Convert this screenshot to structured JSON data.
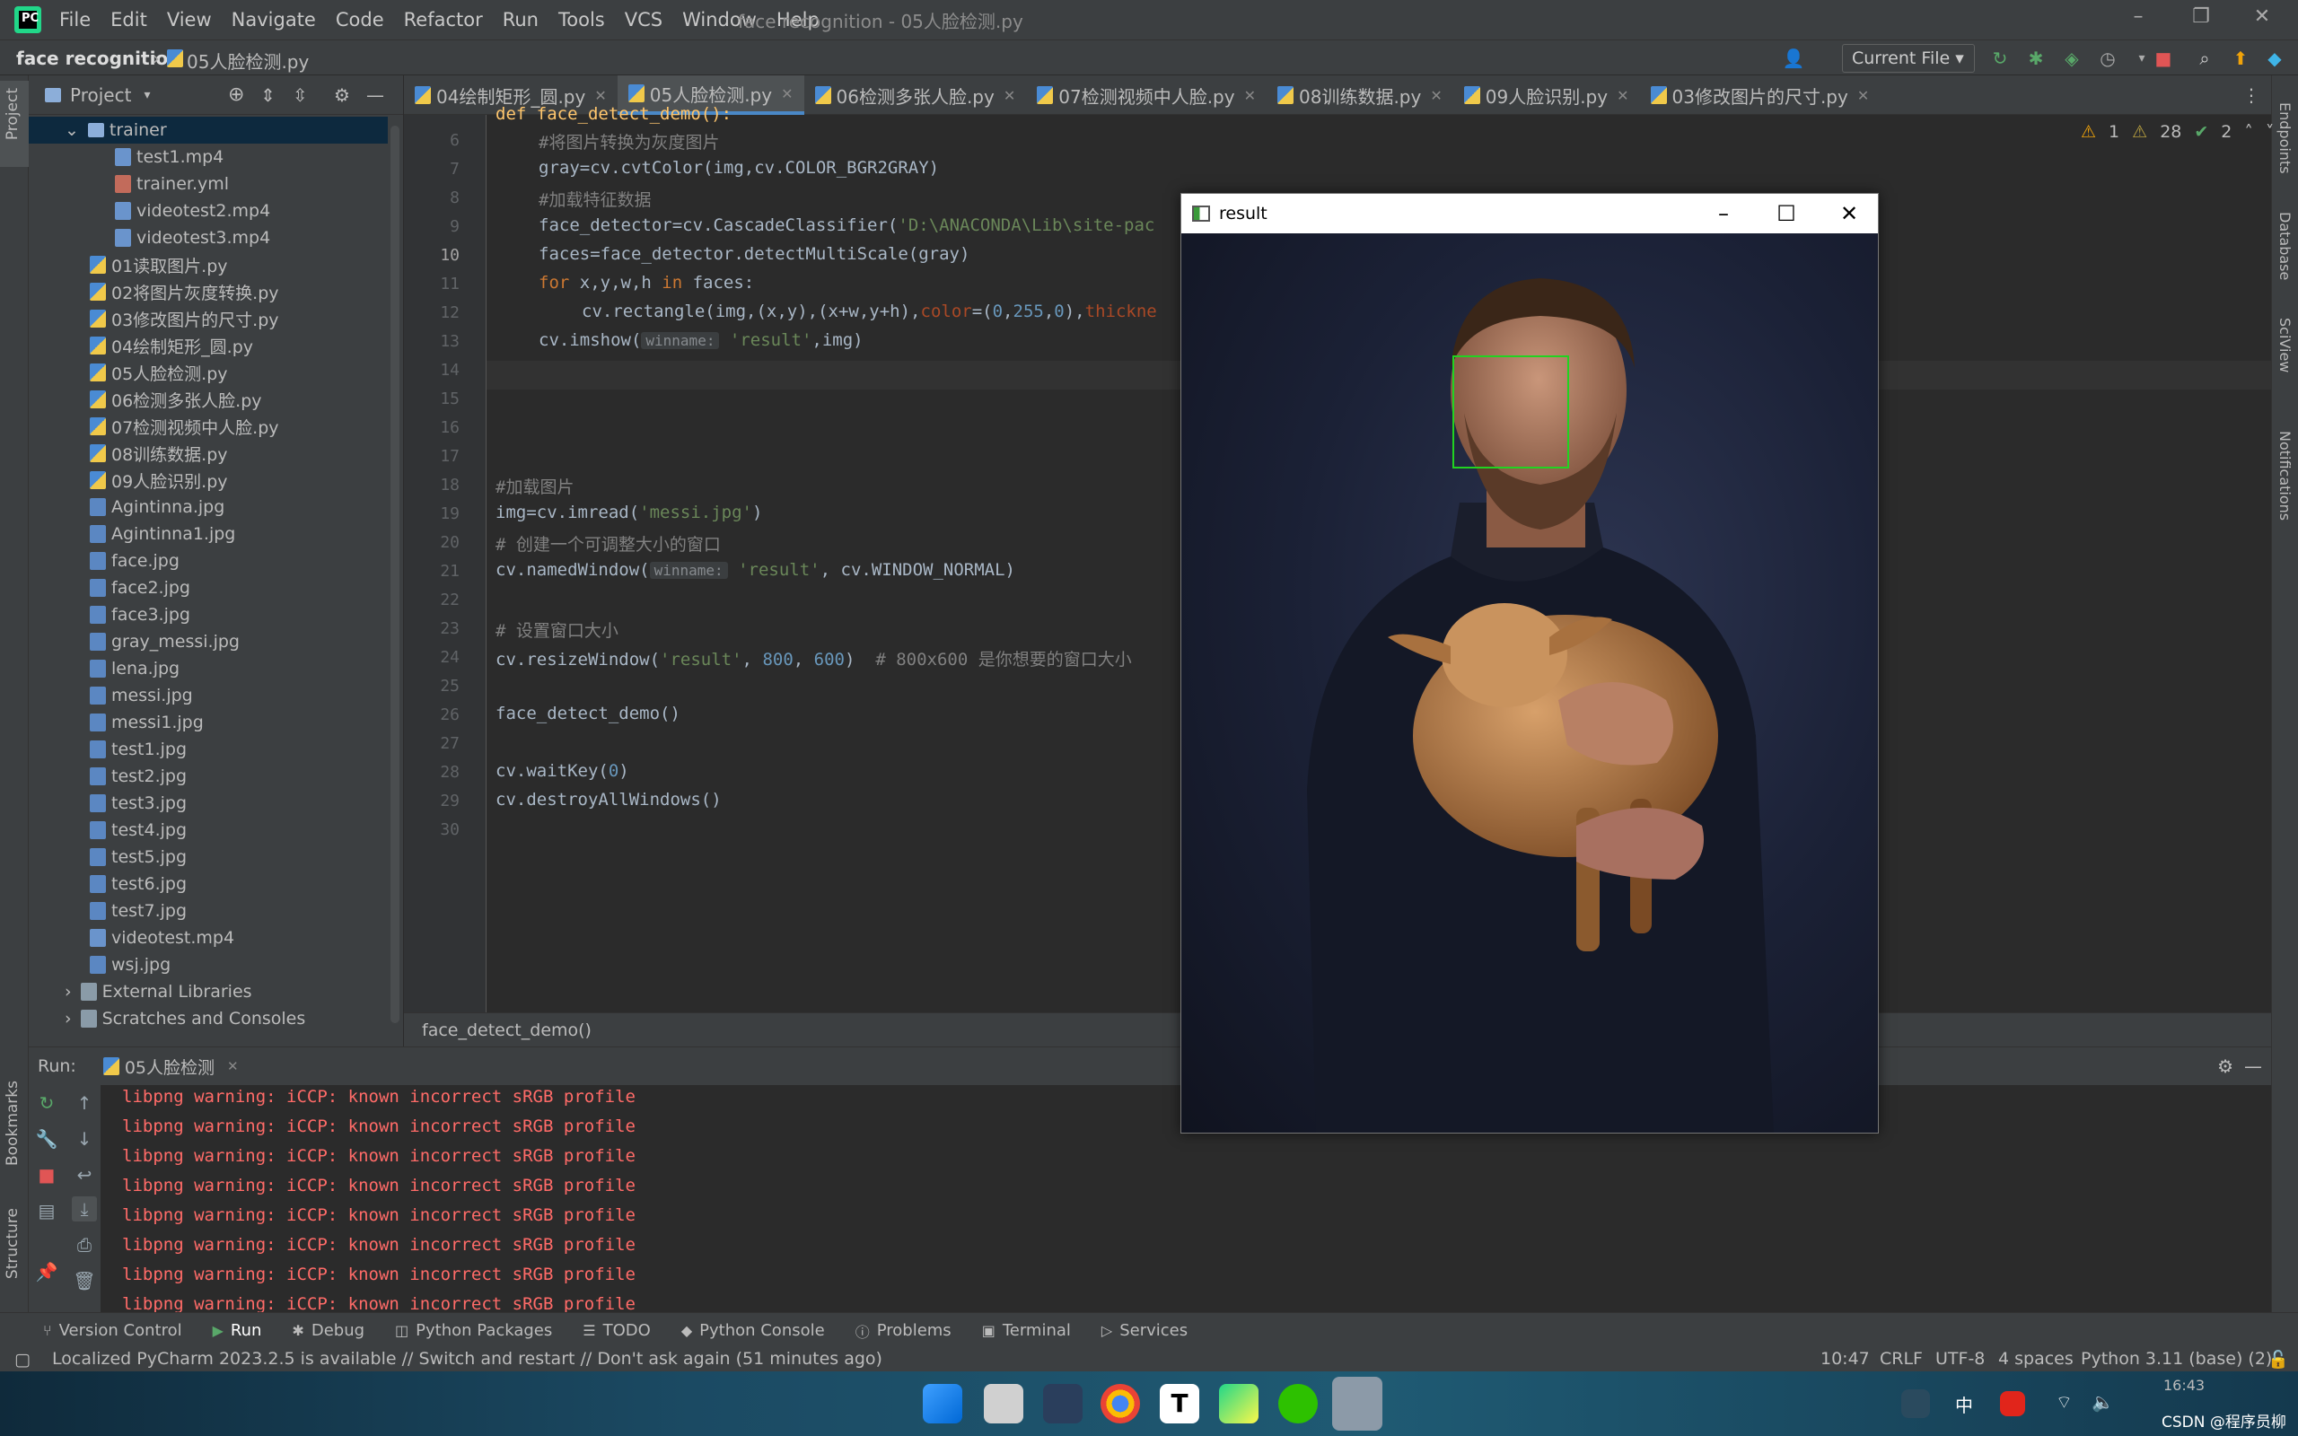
{
  "app": {
    "logo_text": "PC",
    "menu": [
      "File",
      "Edit",
      "View",
      "Navigate",
      "Code",
      "Refactor",
      "Run",
      "Tools",
      "VCS",
      "Window",
      "Help"
    ],
    "window_title": "face recognition - 05人脸检测.py"
  },
  "navbar": {
    "project": "face recognition",
    "file": "05人脸检测.py",
    "run_config": "Current File"
  },
  "left_tool_tabs": [
    "Project",
    "Bookmarks",
    "Structure"
  ],
  "right_tool_tabs": [
    "Endpoints",
    "Database",
    "SciView",
    "Notifications"
  ],
  "project_panel": {
    "title": "Project",
    "tree": [
      {
        "label": "trainer",
        "type": "folder",
        "indent": 1,
        "expanded": true
      },
      {
        "label": "test1.mp4",
        "type": "mp4",
        "indent": 2
      },
      {
        "label": "trainer.yml",
        "type": "yml",
        "indent": 2
      },
      {
        "label": "videotest2.mp4",
        "type": "mp4",
        "indent": 2
      },
      {
        "label": "videotest3.mp4",
        "type": "mp4",
        "indent": 2
      },
      {
        "label": "01读取图片.py",
        "type": "py",
        "indent": 1
      },
      {
        "label": "02将图片灰度转换.py",
        "type": "py",
        "indent": 1
      },
      {
        "label": "03修改图片的尺寸.py",
        "type": "py",
        "indent": 1
      },
      {
        "label": "04绘制矩形_圆.py",
        "type": "py",
        "indent": 1
      },
      {
        "label": "05人脸检测.py",
        "type": "py",
        "indent": 1
      },
      {
        "label": "06检测多张人脸.py",
        "type": "py",
        "indent": 1
      },
      {
        "label": "07检测视频中人脸.py",
        "type": "py",
        "indent": 1
      },
      {
        "label": "08训练数据.py",
        "type": "py",
        "indent": 1
      },
      {
        "label": "09人脸识别.py",
        "type": "py",
        "indent": 1
      },
      {
        "label": "Agintinna.jpg",
        "type": "img",
        "indent": 1
      },
      {
        "label": "Agintinna1.jpg",
        "type": "img",
        "indent": 1
      },
      {
        "label": "face.jpg",
        "type": "img",
        "indent": 1
      },
      {
        "label": "face2.jpg",
        "type": "img",
        "indent": 1
      },
      {
        "label": "face3.jpg",
        "type": "img",
        "indent": 1
      },
      {
        "label": "gray_messi.jpg",
        "type": "img",
        "indent": 1
      },
      {
        "label": "lena.jpg",
        "type": "img",
        "indent": 1
      },
      {
        "label": "messi.jpg",
        "type": "img",
        "indent": 1
      },
      {
        "label": "messi1.jpg",
        "type": "img",
        "indent": 1
      },
      {
        "label": "test1.jpg",
        "type": "img",
        "indent": 1
      },
      {
        "label": "test2.jpg",
        "type": "img",
        "indent": 1
      },
      {
        "label": "test3.jpg",
        "type": "img",
        "indent": 1
      },
      {
        "label": "test4.jpg",
        "type": "img",
        "indent": 1
      },
      {
        "label": "test5.jpg",
        "type": "img",
        "indent": 1
      },
      {
        "label": "test6.jpg",
        "type": "img",
        "indent": 1
      },
      {
        "label": "test7.jpg",
        "type": "img",
        "indent": 1
      },
      {
        "label": "videotest.mp4",
        "type": "mp4",
        "indent": 1
      },
      {
        "label": "wsj.jpg",
        "type": "img",
        "indent": 1
      },
      {
        "label": "External Libraries",
        "type": "lib",
        "indent": 0
      },
      {
        "label": "Scratches and Consoles",
        "type": "lib",
        "indent": 0
      }
    ]
  },
  "tabs": [
    {
      "label": "04绘制矩形_圆.py",
      "active": false
    },
    {
      "label": "05人脸检测.py",
      "active": true
    },
    {
      "label": "06检测多张人脸.py",
      "active": false
    },
    {
      "label": "07检测视频中人脸.py",
      "active": false
    },
    {
      "label": "08训练数据.py",
      "active": false
    },
    {
      "label": "09人脸识别.py",
      "active": false
    },
    {
      "label": "03修改图片的尺寸.py",
      "active": false
    }
  ],
  "inspections": {
    "warnings": "1",
    "weak": "28",
    "ok": "2"
  },
  "editor": {
    "line_numbers": [
      "6",
      "7",
      "8",
      "9",
      "10",
      "11",
      "12",
      "13",
      "14",
      "15",
      "16",
      "17",
      "18",
      "19",
      "20",
      "21",
      "22",
      "23",
      "24",
      "25",
      "26",
      "27",
      "28",
      "29",
      "30"
    ],
    "top_partial": "def face_detect_demo():",
    "lines": {
      "l6": "#将图片转换为灰度图片",
      "l7a": "gray=cv.cvtColor(img",
      "l7b": ",cv.COLOR_BGR2GRAY)",
      "l8": "#加载特征数据",
      "l9a": "face_detector=cv.CascadeClassifier(",
      "l9b": "'D:\\ANACONDA\\Lib\\site-pac",
      "l10": "faces=face_detector.detectMultiScale(gray)",
      "l11a": "for",
      "l11b": " x,y,w,h ",
      "l11c": "in",
      "l11d": " faces:",
      "l12a": "cv.rectangle(img,(x,y),(x+w,y+h),",
      "l12b": "color",
      "l12c": "=(",
      "l12d": "0",
      "l12e": ",",
      "l12f": "255",
      "l12g": ",",
      "l12h": "0",
      "l12i": "),",
      "l12j": "thickne",
      "l13a": "cv.imshow(",
      "l13hint": "winname:",
      "l13b": "'result'",
      "l13c": ",img)",
      "l18": "#加载图片",
      "l19a": "img=cv.imread(",
      "l19b": "'messi.jpg'",
      "l19c": ")",
      "l20": "# 创建一个可调整大小的窗口",
      "l21a": "cv.namedWindow(",
      "l21hint": "winname:",
      "l21b": "'result'",
      "l21c": ", cv.WINDOW_NORMAL)",
      "l23": "# 设置窗口大小",
      "l24a": "cv.resizeWindow(",
      "l24b": "'result'",
      "l24c": ", ",
      "l24d": "800",
      "l24e": ", ",
      "l24f": "600",
      "l24g": ")  ",
      "l24h": "# 800x600 是你想要的窗口大小",
      "l26": "face_detect_demo()",
      "l28a": "cv.waitKey(",
      "l28b": "0",
      "l28c": ")",
      "l29": "cv.destroyAllWindows()"
    },
    "breadcrumb": "face_detect_demo()"
  },
  "run_panel": {
    "label": "Run:",
    "config": "05人脸检测",
    "output": [
      "libpng warning: iCCP: known incorrect sRGB profile",
      "libpng warning: iCCP: known incorrect sRGB profile",
      "libpng warning: iCCP: known incorrect sRGB profile",
      "libpng warning: iCCP: known incorrect sRGB profile",
      "libpng warning: iCCP: known incorrect sRGB profile",
      "libpng warning: iCCP: known incorrect sRGB profile",
      "libpng warning: iCCP: known incorrect sRGB profile",
      "libpng warning: iCCP: known incorrect sRGB profile"
    ]
  },
  "bottom_tabs": [
    "Version Control",
    "Run",
    "Debug",
    "Python Packages",
    "TODO",
    "Python Console",
    "Problems",
    "Terminal",
    "Services"
  ],
  "status": {
    "message": "Localized PyCharm 2023.2.5 is available // Switch and restart // Don't ask again (51 minutes ago)",
    "position": "10:47",
    "line_sep": "CRLF",
    "encoding": "UTF-8",
    "indent": "4 spaces",
    "interpreter": "Python 3.11 (base) (2)"
  },
  "cv_window": {
    "title": "result"
  },
  "taskbar": {
    "ime": "中",
    "watermark": "CSDN @程序员柳",
    "clock_partial": "16:43"
  },
  "colors": {
    "accent": "#4a88c7",
    "error_text": "#ff6b68",
    "face_box": "#21d321"
  }
}
